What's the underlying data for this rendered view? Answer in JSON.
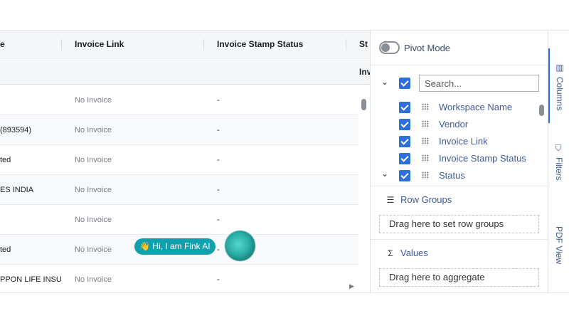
{
  "grid": {
    "headers": [
      "e",
      "Invoice Link",
      "Invoice Stamp Status",
      "St"
    ],
    "filter_row": {
      "partial_label": "Inv"
    },
    "rows": [
      {
        "c0": "",
        "c1": "No Invoice",
        "c2": "-"
      },
      {
        "c0": "(893594)",
        "c1": "No Invoice",
        "c2": "-"
      },
      {
        "c0": "ted",
        "c1": "No Invoice",
        "c2": "-"
      },
      {
        "c0": "ES INDIA",
        "c1": "No Invoice",
        "c2": "-"
      },
      {
        "c0": "",
        "c1": "No Invoice",
        "c2": "-"
      },
      {
        "c0": "ted",
        "c1": "No Invoice",
        "c2": "-"
      },
      {
        "c0": "PPON LIFE INSUI",
        "c1": "No Invoice",
        "c2": "-"
      }
    ]
  },
  "chatbot": {
    "greeting": "👋 Hi, I am Fink AI"
  },
  "panel": {
    "pivot_mode_label": "Pivot Mode",
    "pivot_mode_on": false,
    "search_placeholder": "Search...",
    "columns": [
      {
        "label": "Workspace Name",
        "checked": true
      },
      {
        "label": "Vendor",
        "checked": true
      },
      {
        "label": "Invoice Link",
        "checked": true
      },
      {
        "label": "Invoice Stamp Status",
        "checked": true
      },
      {
        "label": "Status",
        "checked": true
      }
    ],
    "row_groups": {
      "title": "Row Groups",
      "drop_text": "Drag here to set row groups",
      "icon": "row-groups-icon"
    },
    "values": {
      "title": "Values",
      "drop_text": "Drag here to aggregate",
      "icon": "sigma-icon"
    }
  },
  "side_tabs": [
    {
      "label": "Columns",
      "icon": "columns-icon",
      "active": true
    },
    {
      "label": "Filters",
      "icon": "filter-icon",
      "active": false
    },
    {
      "label": "PDF View",
      "icon": "",
      "active": false
    }
  ],
  "colors": {
    "accent": "#2d6ed8",
    "chat_bubble": "#11a1ae",
    "label_blue": "#3d5a96"
  }
}
